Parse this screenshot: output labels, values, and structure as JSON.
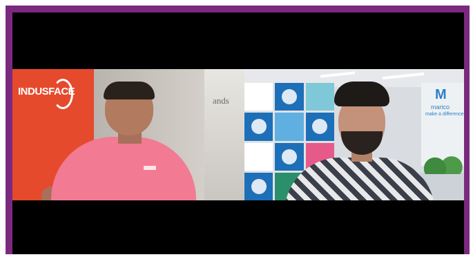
{
  "call": {
    "participants": [
      {
        "id": "left",
        "background_logo_text": "INDUSFACE",
        "background_wall_text": "ands",
        "shirt_color": "#f27a93"
      },
      {
        "id": "right",
        "background_brand_text": "marico",
        "background_brand_tagline": "make a difference",
        "background_brand_glyph": "M",
        "shirt_pattern": "checkered"
      }
    ]
  },
  "colors": {
    "frame_accent": "#7a2a7e",
    "letterbox": "#000000",
    "indusface_red": "#e64a2c",
    "marico_blue": "#2c7fc4"
  },
  "mosaic_tiles": [
    {
      "color": "#ffffff"
    },
    {
      "color": "#1d6fb8"
    },
    {
      "color": "#7fc8d8"
    },
    {
      "color": "#1d6fb8"
    },
    {
      "color": "#5fb0e0"
    },
    {
      "color": "#1d6fb8"
    },
    {
      "color": "#ffffff"
    },
    {
      "color": "#1d6fb8"
    },
    {
      "color": "#e65a8a"
    },
    {
      "color": "#1d6fb8"
    },
    {
      "color": "#2a8f6a"
    },
    {
      "color": "#1d6fb8"
    }
  ]
}
